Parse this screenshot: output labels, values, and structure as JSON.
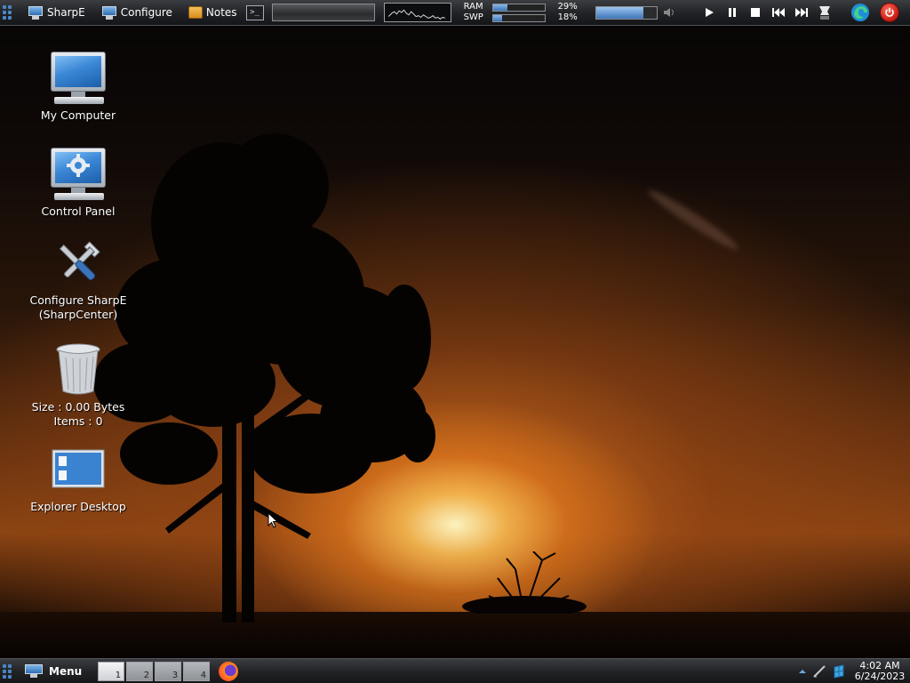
{
  "top_panel": {
    "sharpe_label": "SharpE",
    "configure_label": "Configure",
    "notes_label": "Notes",
    "terminal_glyph": ">_",
    "ram_label": "RAM",
    "ram_pct": "29%",
    "ram_fraction": 0.29,
    "swp_label": "SWP",
    "swp_pct": "18%",
    "swp_fraction": 0.18,
    "volume_fraction": 0.78
  },
  "desktop": {
    "icons": [
      {
        "label": "My Computer",
        "icon": "monitor-icon"
      },
      {
        "label": "Control Panel",
        "icon": "control-panel-icon"
      },
      {
        "label": "Configure SharpE\n(SharpCenter)",
        "icon": "tools-icon"
      },
      {
        "label": "Size : 0.00 Bytes\nItems : 0",
        "icon": "recycle-bin-icon"
      },
      {
        "label": "Explorer Desktop",
        "icon": "explorer-desktop-icon"
      }
    ]
  },
  "bottom_panel": {
    "menu_label": "Menu",
    "pages": [
      "1",
      "2",
      "3",
      "4"
    ],
    "active_page": "1",
    "clock_time": "4:02 AM",
    "clock_date": "6/24/2023"
  },
  "colors": {
    "accent_blue": "#3b74b8",
    "power_red": "#c61b10"
  }
}
